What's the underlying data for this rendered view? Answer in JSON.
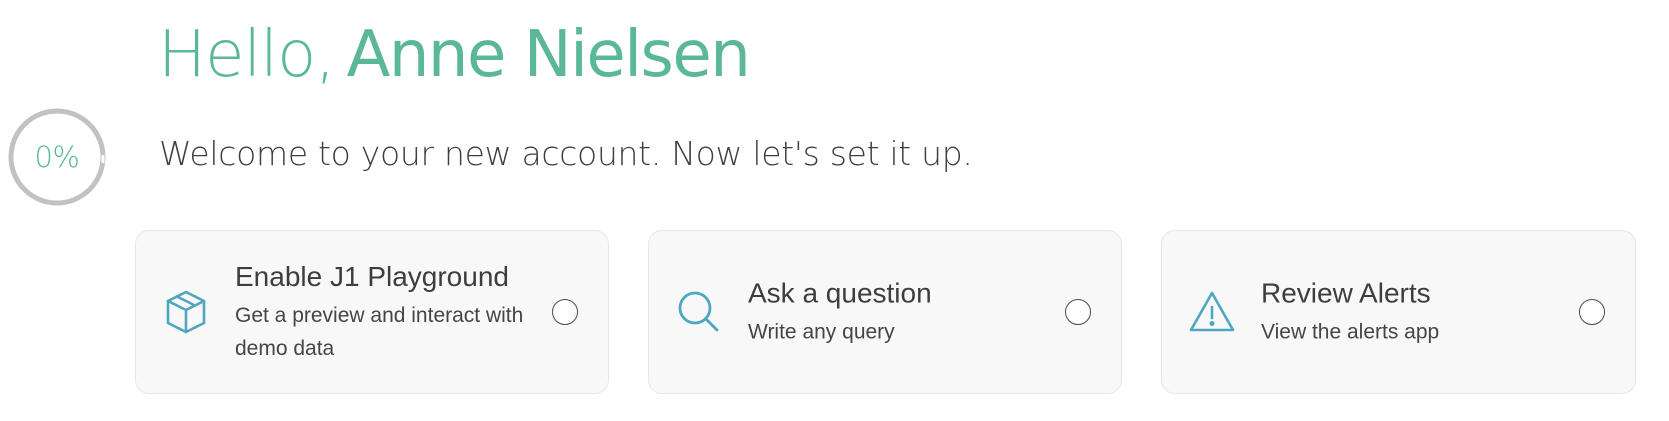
{
  "greeting": {
    "prefix": "Hello,",
    "name": "Anne Nielsen"
  },
  "progress": {
    "label": "0%",
    "value": 0
  },
  "subtitle": "Welcome to your new account. Now let's set it up.",
  "colors": {
    "accent": "#5bb79a",
    "icon": "#4ea6c0",
    "ring": "#c2c2c2"
  },
  "cards": [
    {
      "icon": "box-icon",
      "title": "Enable J1 Playground",
      "description": "Get a preview and interact with demo data",
      "selected": false
    },
    {
      "icon": "search-icon",
      "title": "Ask a question",
      "description": "Write any query",
      "selected": false
    },
    {
      "icon": "alert-triangle-icon",
      "title": "Review Alerts",
      "description": "View the alerts app",
      "selected": false
    }
  ]
}
